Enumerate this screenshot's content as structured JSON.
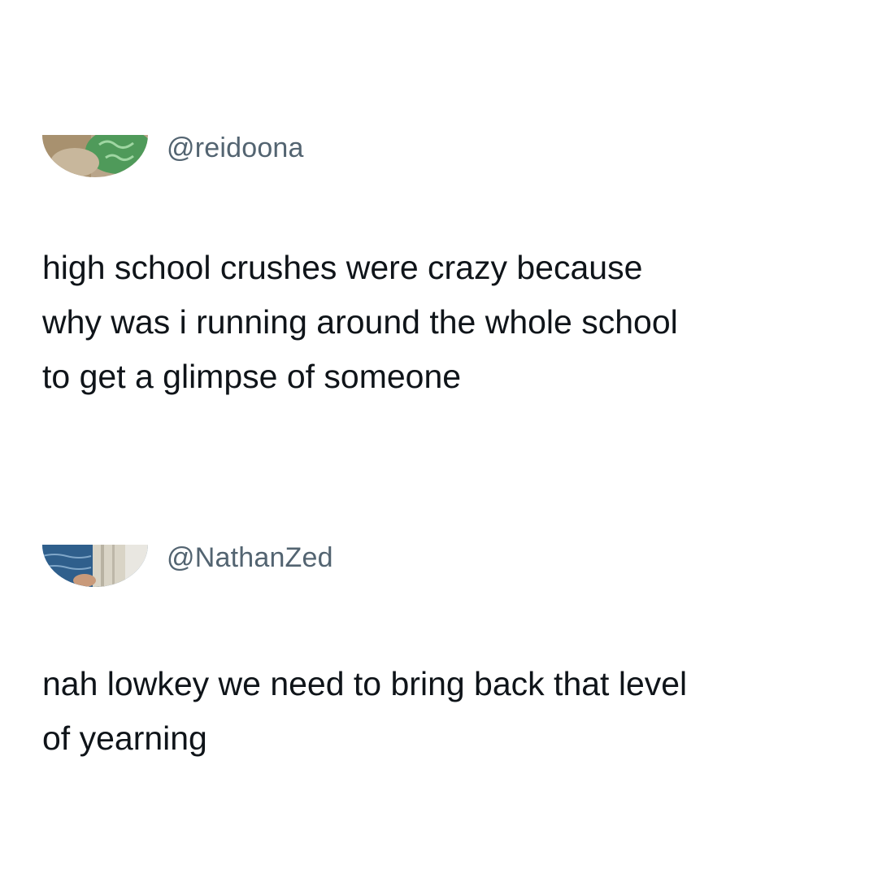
{
  "tweets": [
    {
      "handle": "@reidoona",
      "lines": [
        "high school crushes were crazy because",
        "why was i running around the whole school",
        "to get a glimpse of someone"
      ]
    },
    {
      "handle": "@NathanZed",
      "lines": [
        "nah lowkey we need to bring back that level",
        "of yearning"
      ]
    }
  ]
}
